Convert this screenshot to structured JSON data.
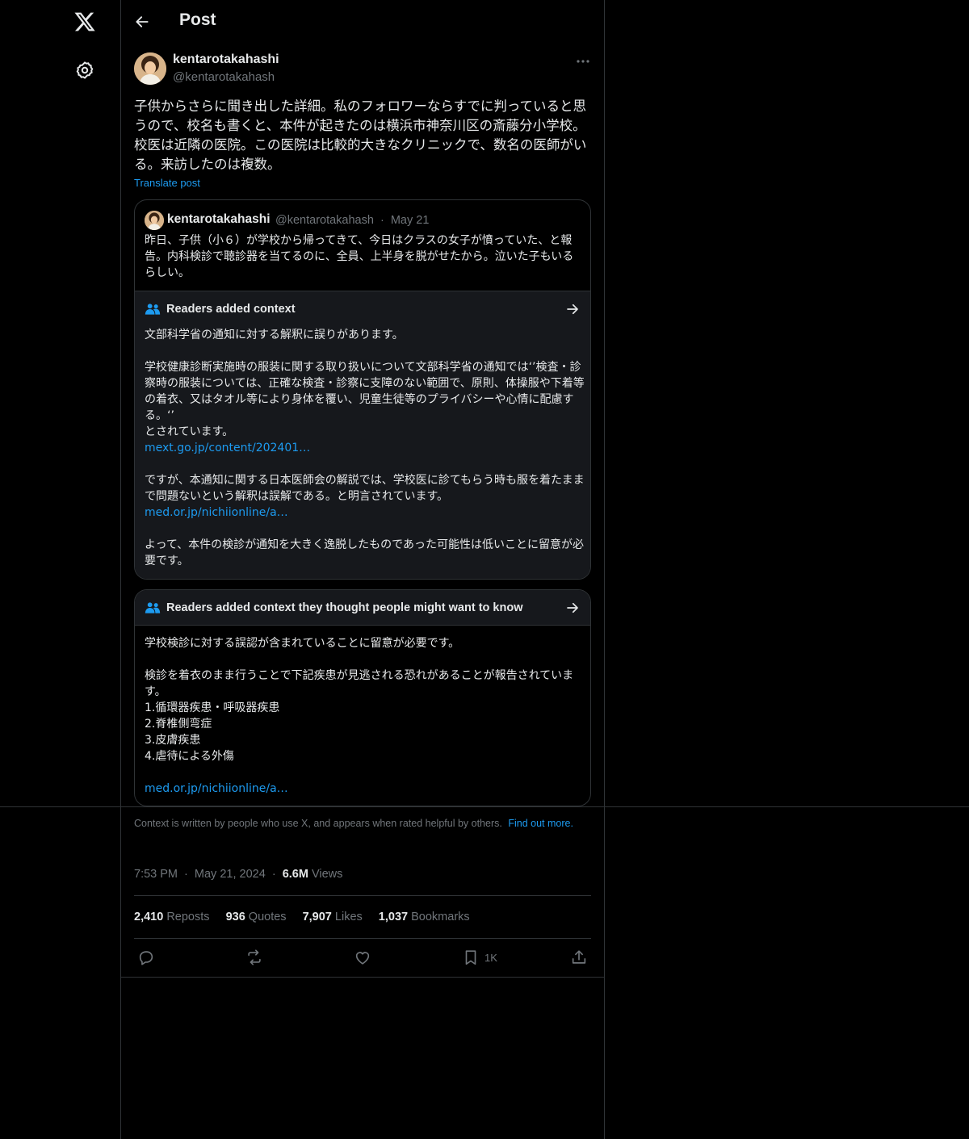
{
  "header": {
    "title": "Post"
  },
  "post": {
    "author_name": "kentarotakahashi",
    "author_handle": "@kentarotakahash",
    "text": "子供からさらに聞き出した詳細。私のフォロワーならすでに判っていると思うので、校名も書くと、本件が起きたのは横浜市神奈川区の斎藤分小学校。校医は近隣の医院。この医院は比較的大きなクリニックで、数名の医師がいる。来訪したのは複数。",
    "translate_label": "Translate post"
  },
  "quote": {
    "author_name": "kentarotakahashi",
    "author_handle": "@kentarotakahash",
    "separator": "·",
    "date": "May 21",
    "text": "昨日、子供（小６）が学校から帰ってきて、今日はクラスの女子が憤っていた、と報告。内科検診で聴診器を当てるのに、全員、上半身を脱がせたから。泣いた子もいるらしい。",
    "note": {
      "title": "Readers added context",
      "p1": "文部科学省の通知に対する解釈に誤りがあります。",
      "p2": "学校健康診断実施時の服装に関する取り扱いについて文部科学省の通知では‘’検査・診察時の服装については、正確な検査・診察に支障のない範囲で、原則、体操服や下着等の着衣、又はタオル等により身体を覆い、児童生徒等のプライバシーや心情に配慮する。‘’",
      "p2b": "とされています。",
      "link1": "mext.go.jp/content/202401…",
      "p3": "ですが、本通知に関する日本医師会の解説では、学校医に診てもらう時も服を着たままで問題ないという解釈は誤解である。と明言されています。",
      "link2": "med.or.jp/nichiionline/a…",
      "p4": "よって、本件の検診が通知を大きく逸脱したものであった可能性は低いことに留意が必要です。"
    }
  },
  "note2": {
    "title": "Readers added context they thought people might want to know",
    "p1": "学校検診に対する誤認が含まれていることに留意が必要です。",
    "p2": "検診を着衣のまま行うことで下記疾患が見逃される恐れがあることが報告されています。",
    "items": [
      "1.循環器疾患・呼吸器疾患",
      "2.脊椎側弯症",
      "3.皮膚疾患",
      "4.虐待による外傷"
    ],
    "link": "med.or.jp/nichiionline/a…"
  },
  "context_footer": {
    "text": "Context is written by people who use X, and appears when rated helpful by others.",
    "find_out": "Find out more."
  },
  "timeline": {
    "time": "7:53 PM",
    "sep": "·",
    "date": "May 21, 2024",
    "views_count": "6.6M",
    "views_label": "Views"
  },
  "stats": {
    "reposts_count": "2,410",
    "reposts_label": "Reposts",
    "quotes_count": "936",
    "quotes_label": "Quotes",
    "likes_count": "7,907",
    "likes_label": "Likes",
    "bookmarks_count": "1,037",
    "bookmarks_label": "Bookmarks"
  },
  "actions": {
    "bookmark_count": "1K"
  },
  "colors": {
    "background": "#000000",
    "text": "#e7e9ea",
    "muted": "#71767b",
    "accent": "#1d9bf0",
    "border": "#2f3336",
    "note_bg": "#16181c"
  },
  "icons": [
    "x-logo-icon",
    "gear-icon",
    "back-arrow-icon",
    "more-icon",
    "readers-icon",
    "arrow-right-icon",
    "reply-icon",
    "repost-icon",
    "like-icon",
    "bookmark-icon",
    "share-icon"
  ]
}
